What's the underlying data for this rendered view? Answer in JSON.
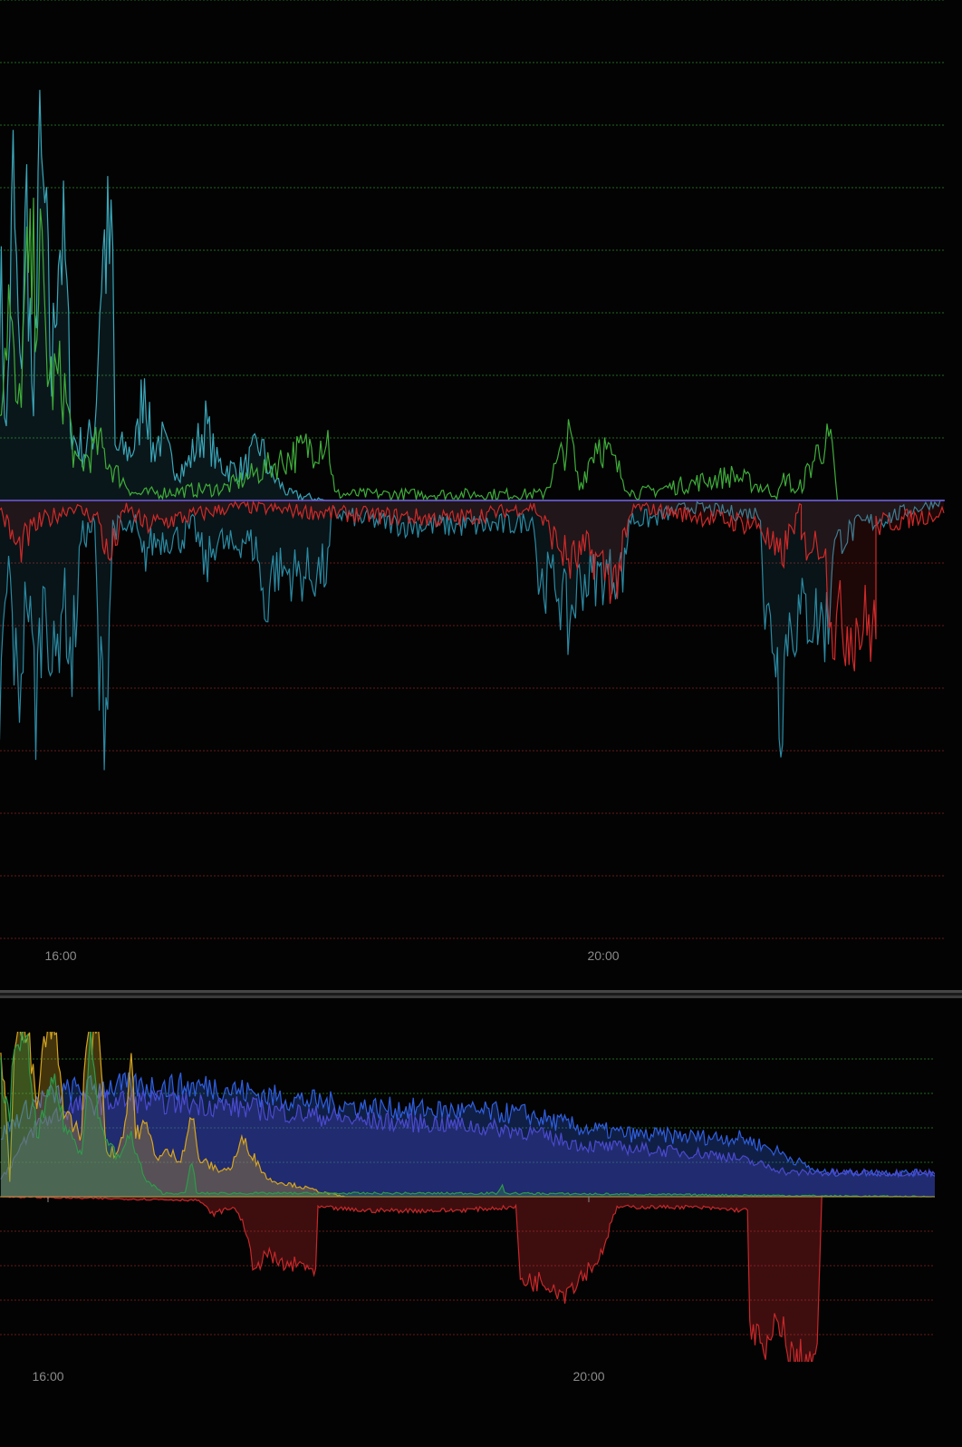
{
  "chart_data": [
    {
      "type": "area",
      "title": "",
      "xlabel": "",
      "ylabel": "",
      "x_units": "minutes from 16:00",
      "y_units": "gridline steps",
      "xlim": [
        -27,
        390
      ],
      "ylim": [
        -7,
        8
      ],
      "grid": true,
      "x_ticks": [
        {
          "m": 0,
          "label": "16:00"
        },
        {
          "m": 240,
          "label": "20:00"
        }
      ],
      "colors": {
        "cyan": "#3aa6b9",
        "green": "#3fae3a",
        "red": "#d02a2a",
        "zero": "#6f5ce0",
        "grid_pos": "#1f6a1f",
        "grid_neg": "#6a1a1a"
      },
      "series": [
        {
          "name": "cyan-positive",
          "color": "#3aa6b9",
          "fill": true,
          "points": [
            [
              -27,
              3.8
            ],
            [
              -24,
              1.0
            ],
            [
              -21,
              5.0
            ],
            [
              -18,
              1.9
            ],
            [
              -15,
              4.7
            ],
            [
              -12,
              1.0
            ],
            [
              -10,
              5.2
            ],
            [
              -7,
              4.5
            ],
            [
              -4,
              1.9
            ],
            [
              -1,
              4.4
            ],
            [
              2,
              3.7
            ],
            [
              5,
              1.0
            ],
            [
              11,
              0.8
            ],
            [
              15,
              1.2
            ],
            [
              18,
              3.8
            ],
            [
              20,
              4.1
            ],
            [
              23,
              3.7
            ],
            [
              24,
              0.8
            ],
            [
              31,
              0.8
            ],
            [
              34,
              1.0
            ],
            [
              37,
              2.1
            ],
            [
              40,
              0.8
            ],
            [
              44,
              1.0
            ],
            [
              49,
              0.6
            ],
            [
              55,
              0.5
            ],
            [
              59,
              0.8
            ],
            [
              64,
              1.2
            ],
            [
              69,
              0.6
            ],
            [
              75,
              0.5
            ],
            [
              81,
              0.5
            ],
            [
              88,
              0.9
            ],
            [
              93,
              0.4
            ],
            [
              101,
              0.1
            ],
            [
              117,
              0
            ],
            [
              390,
              0
            ]
          ]
        },
        {
          "name": "green-positive",
          "color": "#3fae3a",
          "fill": false,
          "points": [
            [
              -27,
              1.6
            ],
            [
              -23,
              3.2
            ],
            [
              -19,
              1.2
            ],
            [
              -15,
              3.4
            ],
            [
              -9,
              3.7
            ],
            [
              -5,
              1.9
            ],
            [
              1,
              1.9
            ],
            [
              7,
              0.5
            ],
            [
              17,
              0.9
            ],
            [
              23,
              0.5
            ],
            [
              33,
              0.1
            ],
            [
              73,
              0.2
            ],
            [
              118,
              1.0
            ],
            [
              121,
              0.1
            ],
            [
              213,
              0.1
            ],
            [
              225,
              1.0
            ],
            [
              229,
              0.2
            ],
            [
              237,
              1.0
            ],
            [
              253,
              0.1
            ],
            [
              297,
              0.4
            ],
            [
              317,
              0.1
            ],
            [
              320,
              0.4
            ],
            [
              325,
              0.1
            ],
            [
              336,
              0.9
            ],
            [
              340,
              0.9
            ],
            [
              343,
              0
            ]
          ]
        },
        {
          "name": "cyan-negative",
          "color": "#2b8aa3",
          "fill": true,
          "points": [
            [
              -27,
              -3.4
            ],
            [
              -23,
              -1.0
            ],
            [
              -19,
              -3.3
            ],
            [
              -15,
              -1.4
            ],
            [
              -11,
              -3.2
            ],
            [
              -7,
              -1.3
            ],
            [
              -3,
              -3.0
            ],
            [
              1,
              -1.4
            ],
            [
              5,
              -2.7
            ],
            [
              9,
              -0.6
            ],
            [
              15,
              -0.4
            ],
            [
              17,
              -3.0
            ],
            [
              20,
              -3.2
            ],
            [
              23,
              -0.4
            ],
            [
              29,
              -0.5
            ],
            [
              33,
              -0.4
            ],
            [
              36,
              -1.0
            ],
            [
              39,
              -0.7
            ],
            [
              45,
              -0.6
            ],
            [
              53,
              -0.6
            ],
            [
              59,
              -0.4
            ],
            [
              64,
              -1.1
            ],
            [
              69,
              -0.6
            ],
            [
              75,
              -0.8
            ],
            [
              81,
              -0.6
            ],
            [
              87,
              -0.8
            ],
            [
              90,
              -1.9
            ],
            [
              93,
              -1.1
            ],
            [
              109,
              -1.2
            ],
            [
              118,
              -1.1
            ],
            [
              120,
              -0.2
            ],
            [
              133,
              -0.3
            ],
            [
              153,
              -0.4
            ],
            [
              173,
              -0.4
            ],
            [
              197,
              -0.4
            ],
            [
              209,
              -0.3
            ],
            [
              211,
              -1.3
            ],
            [
              219,
              -1.3
            ],
            [
              224,
              -2.0
            ],
            [
              229,
              -1.3
            ],
            [
              249,
              -1.1
            ],
            [
              251,
              -0.3
            ],
            [
              261,
              -0.3
            ],
            [
              277,
              -0.1
            ],
            [
              297,
              -0.2
            ],
            [
              309,
              -0.2
            ],
            [
              311,
              -1.9
            ],
            [
              315,
              -2.1
            ],
            [
              318,
              -3.2
            ],
            [
              321,
              -2.0
            ],
            [
              325,
              -1.9
            ],
            [
              329,
              -1.8
            ],
            [
              335,
              -1.9
            ],
            [
              339,
              -2.0
            ],
            [
              341,
              -0.7
            ],
            [
              353,
              -0.4
            ],
            [
              390,
              0
            ]
          ]
        },
        {
          "name": "red-negative",
          "color": "#d02a2a",
          "fill": true,
          "points": [
            [
              -27,
              -0.1
            ],
            [
              -19,
              -0.8
            ],
            [
              -11,
              -0.4
            ],
            [
              5,
              -0.1
            ],
            [
              17,
              -0.3
            ],
            [
              21,
              -1.0
            ],
            [
              29,
              -0.1
            ],
            [
              37,
              -0.4
            ],
            [
              77,
              -0.1
            ],
            [
              117,
              -0.2
            ],
            [
              173,
              -0.3
            ],
            [
              209,
              -0.1
            ],
            [
              225,
              -1.0
            ],
            [
              233,
              -0.8
            ],
            [
              245,
              -1.3
            ],
            [
              253,
              -0.1
            ],
            [
              309,
              -0.4
            ],
            [
              317,
              -1.0
            ],
            [
              327,
              -0.1
            ],
            [
              327,
              -0.7
            ],
            [
              337,
              -0.7
            ],
            [
              341,
              -2.0
            ],
            [
              360,
              -2.0
            ],
            [
              360,
              -0.4
            ],
            [
              373,
              -0.3
            ],
            [
              390,
              -0.2
            ]
          ]
        }
      ]
    },
    {
      "type": "area",
      "title": "",
      "xlabel": "",
      "ylabel": "",
      "x_units": "minutes from 16:00",
      "y_units": "gridline steps",
      "xlim": [
        -21,
        395
      ],
      "ylim": [
        -4.7,
        4.8
      ],
      "grid": true,
      "x_ticks": [
        {
          "m": 0,
          "label": "16:00"
        },
        {
          "m": 240,
          "label": "20:00"
        }
      ],
      "colors": {
        "grid_pos": "#1f6a1f",
        "grid_neg": "#6a1a1a",
        "zero": "#b59a4a"
      },
      "series": [
        {
          "name": "blue-upper",
          "color": "#2f5fe0",
          "fill": true,
          "points": [
            [
              -21,
              1.8
            ],
            [
              -5,
              2.8
            ],
            [
              11,
              3.1
            ],
            [
              27,
              3.2
            ],
            [
              75,
              3.2
            ],
            [
              100,
              2.9
            ],
            [
              140,
              2.6
            ],
            [
              180,
              2.5
            ],
            [
              212,
              2.4
            ],
            [
              237,
              2.0
            ],
            [
              261,
              1.8
            ],
            [
              309,
              1.7
            ],
            [
              325,
              1.3
            ],
            [
              343,
              0.7
            ],
            [
              395,
              0.7
            ]
          ]
        },
        {
          "name": "blue-lower",
          "color": "#4a4ad0",
          "fill": true,
          "points": [
            [
              -21,
              0.5
            ],
            [
              -5,
              2.1
            ],
            [
              11,
              2.6
            ],
            [
              31,
              2.8
            ],
            [
              67,
              2.7
            ],
            [
              100,
              2.5
            ],
            [
              140,
              2.2
            ],
            [
              180,
              2.1
            ],
            [
              212,
              1.9
            ],
            [
              237,
              1.5
            ],
            [
              261,
              1.4
            ],
            [
              301,
              1.2
            ],
            [
              325,
              0.8
            ],
            [
              329,
              0.7
            ],
            [
              395,
              0.7
            ]
          ]
        },
        {
          "name": "yellow",
          "color": "#d6a520",
          "fill": true,
          "points": [
            [
              -21,
              4.7
            ],
            [
              -17,
              0.5
            ],
            [
              -15,
              4.7
            ],
            [
              -9,
              4.7
            ],
            [
              -5,
              2.6
            ],
            [
              -1,
              4.7
            ],
            [
              3,
              4.7
            ],
            [
              7,
              2.6
            ],
            [
              11,
              2.1
            ],
            [
              15,
              1.8
            ],
            [
              17,
              4.7
            ],
            [
              23,
              4.7
            ],
            [
              26,
              1.3
            ],
            [
              31,
              1.3
            ],
            [
              35,
              2.4
            ],
            [
              37,
              4.3
            ],
            [
              39,
              1.8
            ],
            [
              43,
              2.1
            ],
            [
              49,
              1.1
            ],
            [
              53,
              1.3
            ],
            [
              59,
              1.1
            ],
            [
              64,
              2.4
            ],
            [
              67,
              1.1
            ],
            [
              75,
              0.8
            ],
            [
              81,
              0.8
            ],
            [
              87,
              1.7
            ],
            [
              91,
              1.2
            ],
            [
              98,
              0.5
            ],
            [
              112,
              0.3
            ],
            [
              124,
              0.1
            ],
            [
              132,
              0
            ]
          ]
        },
        {
          "name": "green",
          "color": "#2f9a4a",
          "fill": true,
          "points": [
            [
              -21,
              3.7
            ],
            [
              -17,
              2.1
            ],
            [
              -15,
              4.7
            ],
            [
              -9,
              4.2
            ],
            [
              -5,
              1.8
            ],
            [
              3,
              3.4
            ],
            [
              7,
              2.1
            ],
            [
              15,
              1.3
            ],
            [
              19,
              4.7
            ],
            [
              23,
              2.1
            ],
            [
              31,
              1.1
            ],
            [
              37,
              1.8
            ],
            [
              43,
              0.5
            ],
            [
              51,
              0.1
            ],
            [
              61,
              0.1
            ],
            [
              64,
              1.1
            ],
            [
              66,
              0.1
            ],
            [
              200,
              0.1
            ],
            [
              202,
              0.4
            ],
            [
              203,
              0.1
            ],
            [
              395,
              0
            ]
          ]
        },
        {
          "name": "red-negative",
          "color": "#c8282a",
          "fill": true,
          "points": [
            [
              -21,
              0
            ],
            [
              67,
              -0.1
            ],
            [
              73,
              -0.5
            ],
            [
              83,
              -0.3
            ],
            [
              89,
              -1.1
            ],
            [
              91,
              -2.4
            ],
            [
              96,
              -1.6
            ],
            [
              104,
              -2.0
            ],
            [
              116,
              -2.0
            ],
            [
              119,
              -2.4
            ],
            [
              120,
              -0.3
            ],
            [
              140,
              -0.4
            ],
            [
              180,
              -0.4
            ],
            [
              208,
              -0.3
            ],
            [
              210,
              -2.4
            ],
            [
              224,
              -2.5
            ],
            [
              229,
              -2.8
            ],
            [
              245,
              -1.8
            ],
            [
              253,
              -0.3
            ],
            [
              285,
              -0.3
            ],
            [
              311,
              -0.4
            ],
            [
              312,
              -3.6
            ],
            [
              319,
              -4.7
            ],
            [
              323,
              -3.8
            ],
            [
              327,
              -3.6
            ],
            [
              328,
              -4.7
            ],
            [
              342,
              -4.7
            ],
            [
              344,
              0
            ]
          ]
        }
      ]
    }
  ]
}
